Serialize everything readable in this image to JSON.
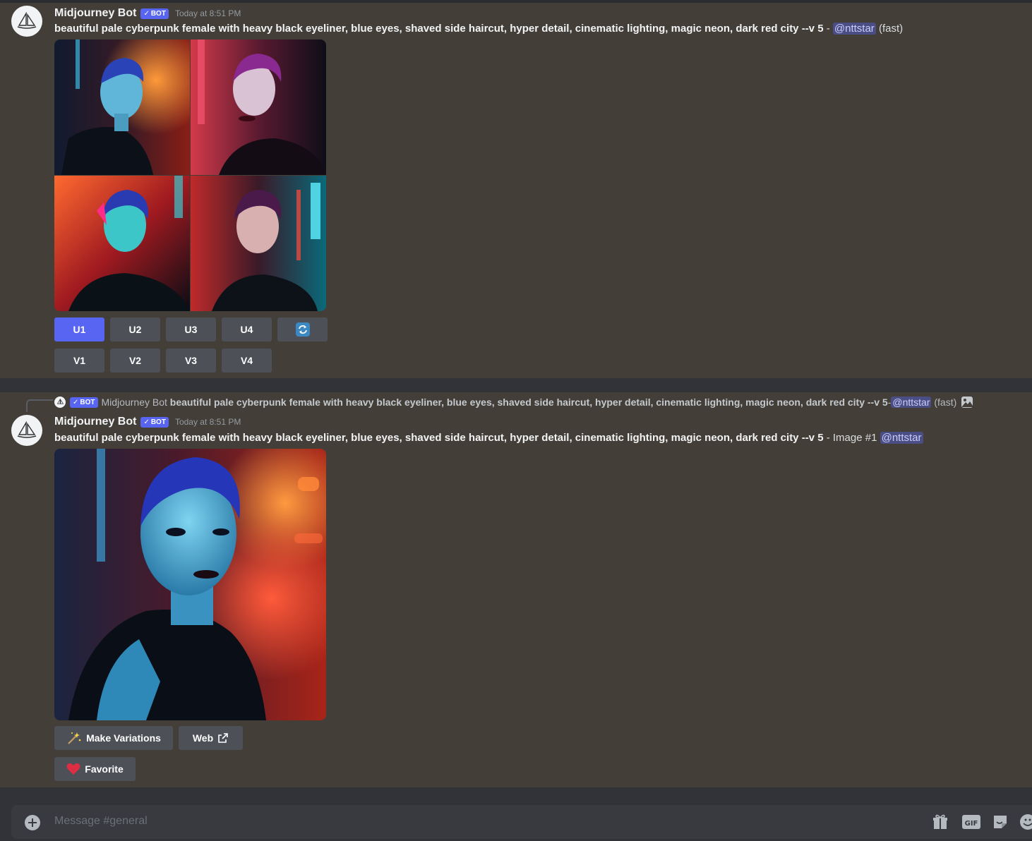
{
  "channel": {
    "input_placeholder": "Message #general"
  },
  "message1": {
    "username": "Midjourney Bot",
    "bot_tag": "BOT",
    "timestamp": "Today at 8:51 PM",
    "prompt": "beautiful pale cyberpunk female with heavy black eyeliner, blue eyes, shaved side haircut, hyper detail, cinematic lighting, magic neon, dark red city --v 5",
    "separator": " - ",
    "mention": "@nttstar",
    "suffix": "(fast)",
    "buttons_row1": [
      "U1",
      "U2",
      "U3",
      "U4"
    ],
    "buttons_row2": [
      "V1",
      "V2",
      "V3",
      "V4"
    ],
    "refresh_icon": "refresh-icon"
  },
  "reply": {
    "bot_tag": "BOT",
    "username": "Midjourney Bot",
    "prompt": "beautiful pale cyberpunk female with heavy black eyeliner, blue eyes, shaved side haircut, hyper detail, cinematic lighting, magic neon, dark red city --v 5",
    "separator": " - ",
    "mention": "@nttstar",
    "suffix": "(fast)"
  },
  "message2": {
    "username": "Midjourney Bot",
    "bot_tag": "BOT",
    "timestamp": "Today at 8:51 PM",
    "prompt": "beautiful pale cyberpunk female with heavy black eyeliner, blue eyes, shaved side haircut, hyper detail, cinematic lighting, magic neon, dark red city --v 5",
    "image_label": " - Image #1 ",
    "mention": "@nttstar",
    "make_variations": "Make Variations",
    "web": "Web",
    "favorite": "Favorite"
  },
  "colors": {
    "accent": "#5865f2",
    "message_bg": "#433e38",
    "button": "#4e5058",
    "mention_bg": "#4a4e85"
  }
}
